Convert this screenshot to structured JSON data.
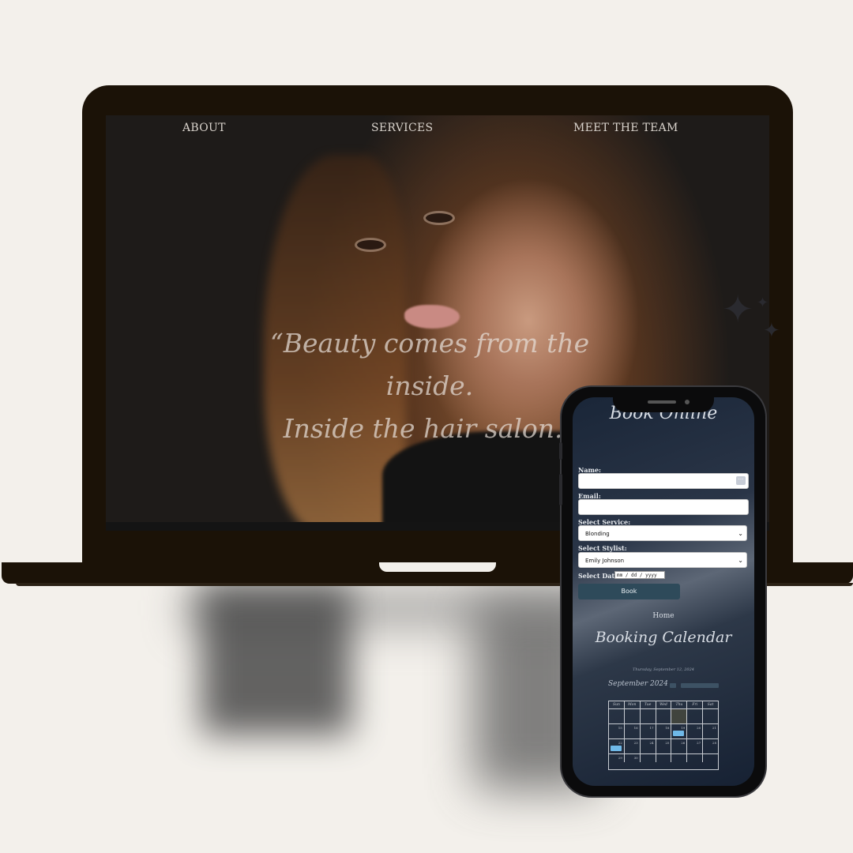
{
  "laptop_site": {
    "nav": {
      "about": "ABOUT",
      "services": "SERVICES",
      "team": "MEET THE TEAM"
    },
    "quote": {
      "line1": "“Beauty comes from the inside.",
      "line2": "Inside the hair salon.”"
    }
  },
  "phone_site": {
    "booking": {
      "title": "Book Online",
      "name_label": "Name:",
      "email_label": "Email:",
      "service_label": "Select Service:",
      "service_value": "Blonding",
      "stylist_label": "Select Stylist:",
      "stylist_value": "Emily Johnson",
      "date_label": "Select Date:",
      "date_placeholder": "mm / dd / yyyy",
      "book_button": "Book"
    },
    "home_link": "Home",
    "calendar": {
      "title": "Booking Calendar",
      "current_date": "Thursday, September 12, 2024",
      "month": "September 2024",
      "weekdays": [
        "Sun",
        "Mon",
        "Tue",
        "Wed",
        "Thu",
        "Fri",
        "Sat"
      ],
      "rows": [
        [
          "15",
          "16",
          "17",
          "18",
          "19",
          "20",
          "21"
        ],
        [
          "22",
          "23",
          "24",
          "25",
          "26",
          "27",
          "28"
        ],
        [
          "29",
          "30",
          "",
          "",
          "",
          "",
          ""
        ]
      ]
    }
  },
  "colors": {
    "background": "#f3f0eb",
    "device_frame": "#1b1207",
    "button": "#2e4a5a",
    "event": "#6fb9e8"
  }
}
